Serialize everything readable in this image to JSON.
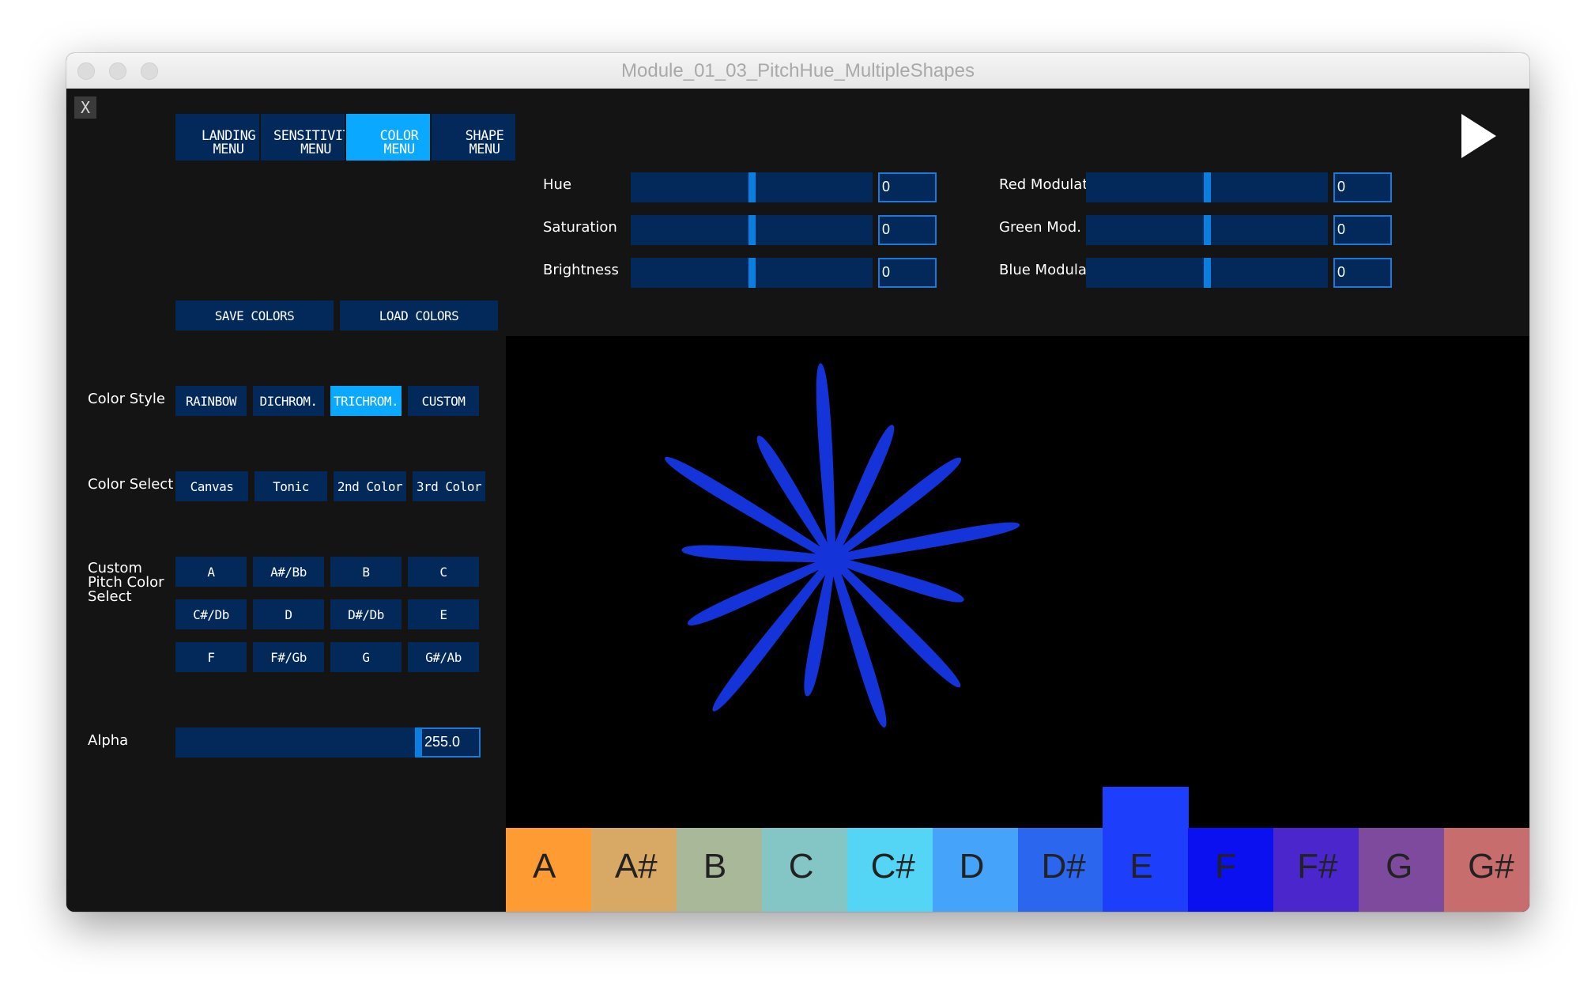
{
  "window": {
    "title": "Module_01_03_PitchHue_MultipleShapes"
  },
  "close_label": "X",
  "menu_tabs": [
    {
      "label": "LANDING MENU",
      "active": false
    },
    {
      "label": "SENSITIVITY MENU",
      "active": false
    },
    {
      "label": "COLOR MENU",
      "active": true
    },
    {
      "label": "SHAPE MENU",
      "active": false
    }
  ],
  "hsb_sliders": [
    {
      "label": "Hue",
      "value": "0",
      "level": 0.5
    },
    {
      "label": "Saturation",
      "value": "0",
      "level": 0.5
    },
    {
      "label": "Brightness",
      "value": "0",
      "level": 0.5
    }
  ],
  "rgb_sliders": [
    {
      "label": "Red Modulate",
      "value": "0",
      "level": 0.5
    },
    {
      "label": "Green Mod.",
      "value": "0",
      "level": 0.5
    },
    {
      "label": "Blue Modulate",
      "value": "0",
      "level": 0.5
    }
  ],
  "save_colors_label": "SAVE COLORS",
  "load_colors_label": "LOAD COLORS",
  "color_style": {
    "label": "Color Style",
    "options": [
      "RAINBOW",
      "DICHROM.",
      "TRICHROM.",
      "CUSTOM"
    ],
    "selected": "TRICHROM."
  },
  "color_select": {
    "label": "Color Select",
    "options": [
      "Canvas",
      "Tonic",
      "2nd Color",
      "3rd Color"
    ]
  },
  "custom_pitch": {
    "label": "Custom Pitch Color Select",
    "pitches": [
      "A",
      "A#/Bb",
      "B",
      "C",
      "C#/Db",
      "D",
      "D#/Db",
      "E",
      "F",
      "F#/Gb",
      "G",
      "G#/Ab"
    ]
  },
  "alpha": {
    "label": "Alpha",
    "value": "255.0",
    "level": 1.0
  },
  "shape": {
    "color": "#1433d9",
    "petals": 13
  },
  "keys": [
    {
      "note": "A",
      "color": "#ff9b33",
      "level": 0
    },
    {
      "note": "A#",
      "color": "#d8a865",
      "level": 0
    },
    {
      "note": "B",
      "color": "#a9b898",
      "level": 0
    },
    {
      "note": "C",
      "color": "#84c6c6",
      "level": 0
    },
    {
      "note": "C#",
      "color": "#55d5f5",
      "level": 0
    },
    {
      "note": "D",
      "color": "#45a3fa",
      "level": 0
    },
    {
      "note": "D#",
      "color": "#2b66ee",
      "level": 0
    },
    {
      "note": "E",
      "color": "#1d3ffb",
      "level": 1
    },
    {
      "note": "F",
      "color": "#0a10f0",
      "level": 0
    },
    {
      "note": "F#",
      "color": "#4a26cc",
      "level": 0
    },
    {
      "note": "G",
      "color": "#7d4a9e",
      "level": 0
    },
    {
      "note": "G#",
      "color": "#c86d6e",
      "level": 0
    }
  ]
}
